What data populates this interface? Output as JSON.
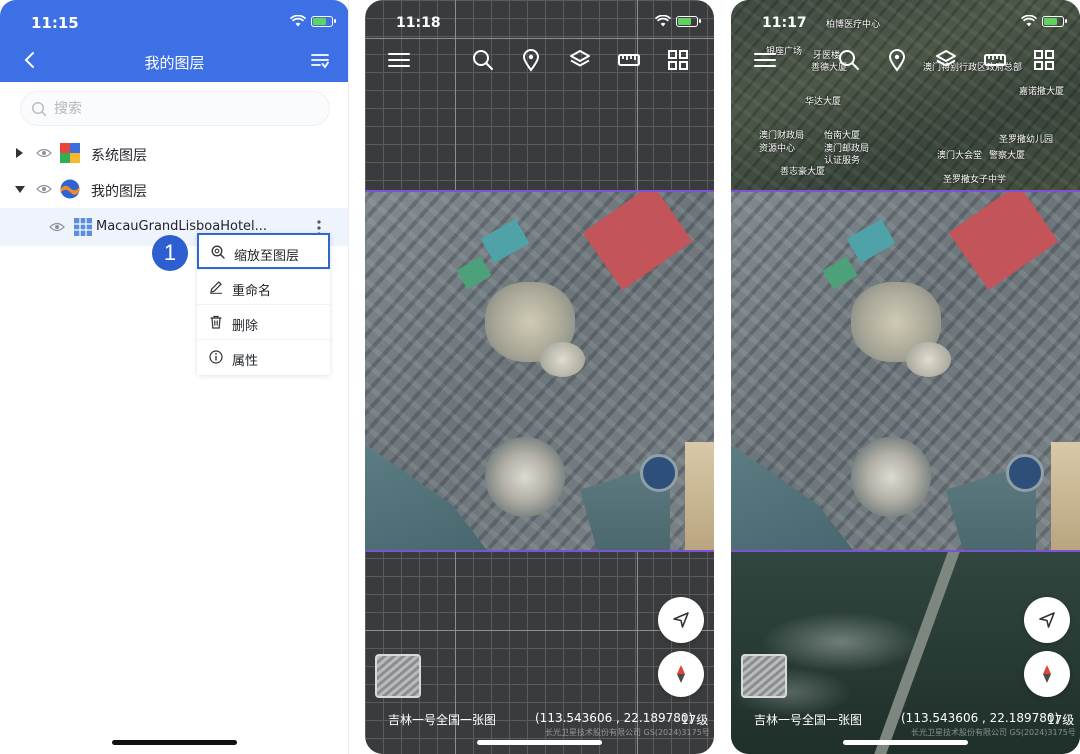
{
  "phone1": {
    "status_time": "11:15",
    "title": "我的图层",
    "search_placeholder": "搜索",
    "tree": {
      "system_layers": "系统图层",
      "my_layers": "我的图层",
      "layer_file": "MacauGrandLisboaHotel..."
    },
    "context_menu": {
      "zoom_to_layer": "缩放至图层",
      "rename": "重命名",
      "delete": "删除",
      "properties": "属性"
    },
    "step_badge": "1",
    "colors": {
      "header": "#3d70e4",
      "highlight_border": "#2f66d2",
      "selected_row": "#eef3fc"
    }
  },
  "phone2": {
    "status_time": "11:18",
    "basemap_name": "吉林一号全国一张图",
    "coordinates": "(113.543606 , 22.189780)",
    "zoom_level": "17级",
    "copyright": "长光卫星技术股份有限公司 GS(2024)3175号"
  },
  "phone3": {
    "status_time": "11:17",
    "basemap_name": "吉林一号全国一张图",
    "coordinates": "(113.543606 , 22.189780)",
    "zoom_level": "17级",
    "copyright": "长光卫星技术股份有限公司 GS(2024)3175号",
    "map_labels": {
      "l1": "柏博医疗中心",
      "l2": "银座广场",
      "l3": "牙医楼",
      "l4": "善德大厦",
      "l5": "澳门特别行政区政府总部",
      "l6": "华达大厦",
      "l7": "澳门财政局",
      "l8": "资源中心",
      "l9": "怡南大厦",
      "l10": "澳门邮政局",
      "l11": "认证服务",
      "l12": "澳门大会堂",
      "l13": "警察大厦",
      "l14": "圣罗撒女子中学",
      "l15": "善志豪大厦",
      "l16": "圣罗撒幼儿园",
      "l17": "嘉诺撒大厦"
    }
  },
  "colors": {
    "outline": "#7c52d6"
  }
}
